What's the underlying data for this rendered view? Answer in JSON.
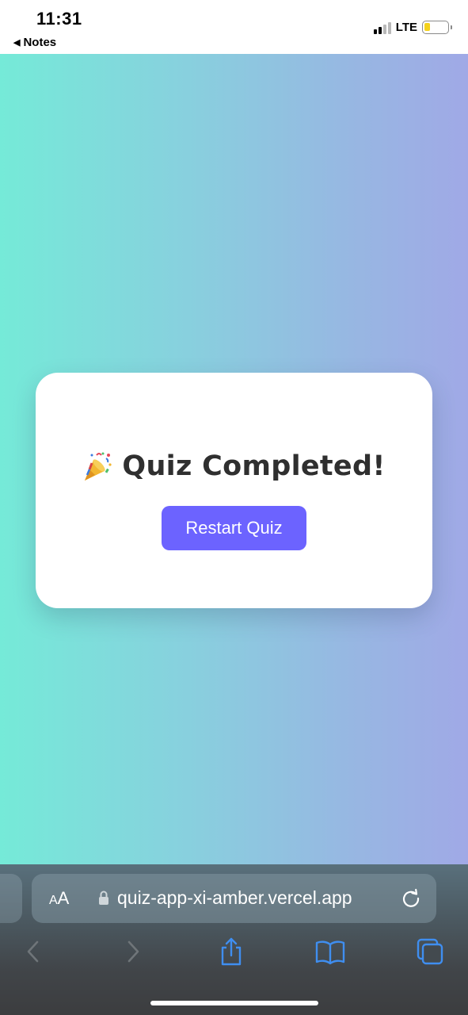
{
  "status_bar": {
    "time": "11:31",
    "back_app_label": "Notes",
    "network": "LTE",
    "signal_bars_active": 2,
    "signal_bars_total": 4,
    "battery_level": 0.25,
    "battery_color": "#f5d21c"
  },
  "page": {
    "background_start": "#75ead8",
    "background_end": "#a0a9e6",
    "card": {
      "title": "Quiz Completed!",
      "title_icon": "party-popper-icon",
      "restart_label": "Restart Quiz",
      "button_color": "#6c63ff"
    }
  },
  "browser": {
    "text_size_label_small": "A",
    "text_size_label_big": "A",
    "url": "quiz-app-xi-amber.vercel.app",
    "toolbar_icons": [
      "back-icon",
      "forward-icon",
      "share-icon",
      "bookmarks-icon",
      "tabs-icon"
    ],
    "accent": "#3f8ef0"
  }
}
